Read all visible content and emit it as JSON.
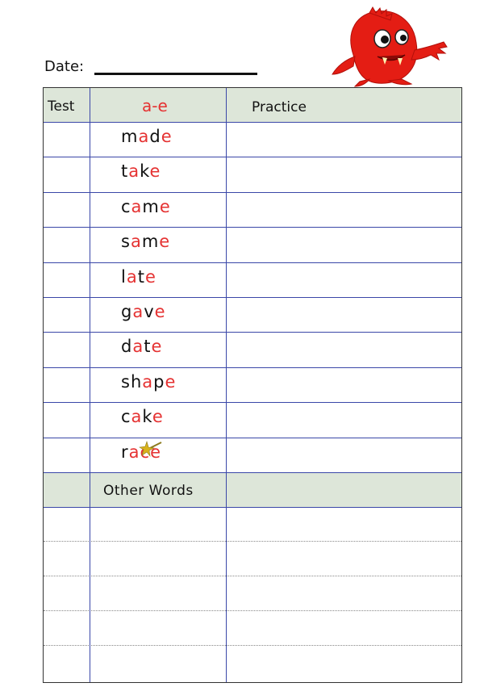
{
  "header": {
    "date_label": "Date:"
  },
  "table": {
    "col_test": "Test",
    "col_pattern": "a-e",
    "col_practice": "Practice",
    "words": [
      {
        "word": "made",
        "parts": [
          {
            "t": "m",
            "c": "k"
          },
          {
            "t": "a",
            "c": "r"
          },
          {
            "t": "d",
            "c": "k"
          },
          {
            "t": "e",
            "c": "r"
          }
        ]
      },
      {
        "word": "take",
        "parts": [
          {
            "t": "t",
            "c": "k"
          },
          {
            "t": "a",
            "c": "r"
          },
          {
            "t": "k",
            "c": "k"
          },
          {
            "t": "e",
            "c": "r"
          }
        ]
      },
      {
        "word": "came",
        "parts": [
          {
            "t": "c",
            "c": "k"
          },
          {
            "t": "a",
            "c": "r"
          },
          {
            "t": "m",
            "c": "k"
          },
          {
            "t": "e",
            "c": "r"
          }
        ]
      },
      {
        "word": "same",
        "parts": [
          {
            "t": "s",
            "c": "k"
          },
          {
            "t": "a",
            "c": "r"
          },
          {
            "t": "m",
            "c": "k"
          },
          {
            "t": "e",
            "c": "r"
          }
        ]
      },
      {
        "word": "late",
        "parts": [
          {
            "t": "l",
            "c": "k"
          },
          {
            "t": "a",
            "c": "r"
          },
          {
            "t": "t",
            "c": "k"
          },
          {
            "t": "e",
            "c": "r"
          }
        ]
      },
      {
        "word": "gave",
        "parts": [
          {
            "t": "g",
            "c": "k"
          },
          {
            "t": "a",
            "c": "r"
          },
          {
            "t": "v",
            "c": "k"
          },
          {
            "t": "e",
            "c": "r"
          }
        ]
      },
      {
        "word": "date",
        "parts": [
          {
            "t": "d",
            "c": "k"
          },
          {
            "t": "a",
            "c": "r"
          },
          {
            "t": "t",
            "c": "k"
          },
          {
            "t": "e",
            "c": "r"
          }
        ]
      },
      {
        "word": "shape",
        "parts": [
          {
            "t": "sh",
            "c": "k"
          },
          {
            "t": "a",
            "c": "r"
          },
          {
            "t": "p",
            "c": "k"
          },
          {
            "t": "e",
            "c": "r"
          }
        ]
      },
      {
        "word": "cake",
        "parts": [
          {
            "t": "c",
            "c": "k"
          },
          {
            "t": "a",
            "c": "r"
          },
          {
            "t": "k",
            "c": "k"
          },
          {
            "t": "e",
            "c": "r"
          }
        ]
      },
      {
        "word": "race",
        "parts": [
          {
            "t": "r",
            "c": "k"
          },
          {
            "t": "a",
            "c": "r"
          },
          {
            "t": "c",
            "c": "r"
          },
          {
            "t": "e",
            "c": "r"
          }
        ]
      }
    ],
    "other_words_label": "Other Words"
  },
  "colors": {
    "accent_red": "#e53232",
    "band_green": "#dde6d9",
    "rule_blue": "#3a47a8"
  },
  "icons": {
    "mascot": "red-monster-icon",
    "sparkle": "magic-wand-icon"
  }
}
